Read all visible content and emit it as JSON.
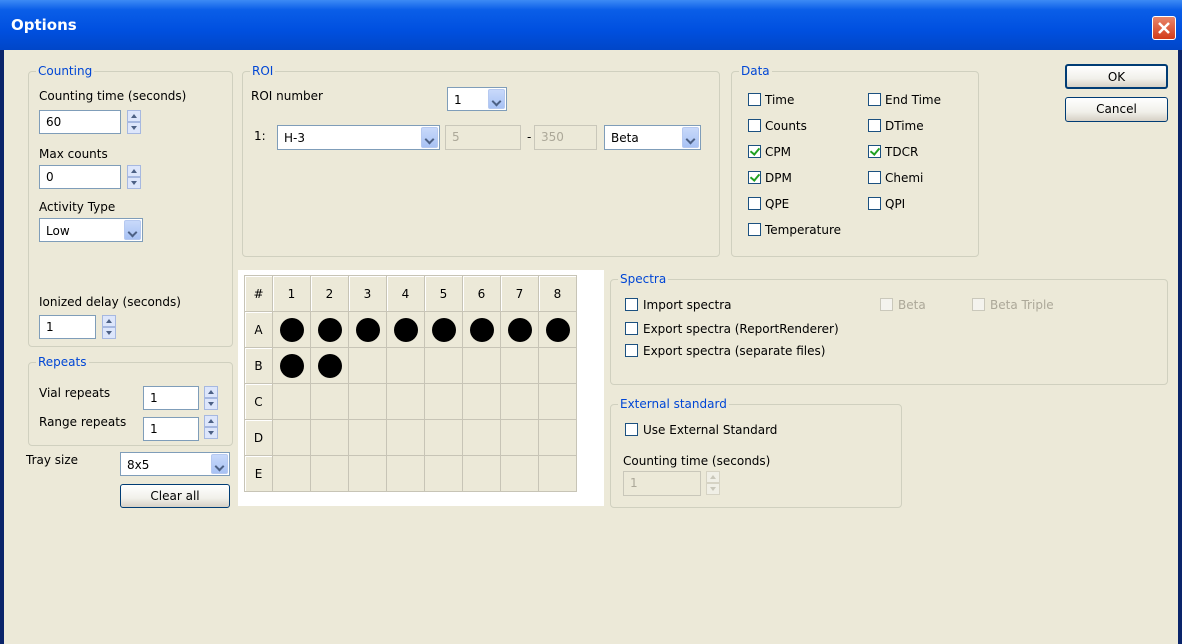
{
  "window": {
    "title": "Options"
  },
  "counting": {
    "legend": "Counting",
    "time_label": "Counting time (seconds)",
    "time_value": "60",
    "max_label": "Max counts",
    "max_value": "0",
    "activity_label": "Activity Type",
    "activity_value": "Low",
    "ionized_label": "Ionized delay (seconds)",
    "ionized_value": "1"
  },
  "repeats": {
    "legend": "Repeats",
    "vial_label": "Vial repeats",
    "vial_value": "1",
    "range_label": "Range repeats",
    "range_value": "1"
  },
  "tray": {
    "size_label": "Tray size",
    "size_value": "8x5",
    "clear_label": "Clear all",
    "corner": "#",
    "columns": [
      "1",
      "2",
      "3",
      "4",
      "5",
      "6",
      "7",
      "8"
    ],
    "rows": [
      {
        "label": "A",
        "filled": [
          true,
          true,
          true,
          true,
          true,
          true,
          true,
          true
        ]
      },
      {
        "label": "B",
        "filled": [
          true,
          true,
          false,
          false,
          false,
          false,
          false,
          false
        ]
      },
      {
        "label": "C",
        "filled": [
          false,
          false,
          false,
          false,
          false,
          false,
          false,
          false
        ]
      },
      {
        "label": "D",
        "filled": [
          false,
          false,
          false,
          false,
          false,
          false,
          false,
          false
        ]
      },
      {
        "label": "E",
        "filled": [
          false,
          false,
          false,
          false,
          false,
          false,
          false,
          false
        ]
      }
    ]
  },
  "roi": {
    "legend": "ROI",
    "number_label": "ROI number",
    "number_value": "1",
    "row_label": "1:",
    "nuclide_value": "H-3",
    "low_value": "5",
    "dash": "-",
    "high_value": "350",
    "type_value": "Beta"
  },
  "data": {
    "legend": "Data",
    "items": [
      {
        "label": "Time",
        "checked": false
      },
      {
        "label": "Counts",
        "checked": false
      },
      {
        "label": "CPM",
        "checked": true
      },
      {
        "label": "DPM",
        "checked": true
      },
      {
        "label": "QPE",
        "checked": false
      },
      {
        "label": "Temperature",
        "checked": false
      },
      {
        "label": "End Time",
        "checked": false
      },
      {
        "label": "DTime",
        "checked": false
      },
      {
        "label": "TDCR",
        "checked": true
      },
      {
        "label": "Chemi",
        "checked": false
      },
      {
        "label": "QPI",
        "checked": false
      }
    ]
  },
  "buttons": {
    "ok": "OK",
    "cancel": "Cancel"
  },
  "spectra": {
    "legend": "Spectra",
    "import_label": "Import spectra",
    "export_report_label": "Export spectra (ReportRenderer)",
    "export_separate_label": "Export spectra (separate files)",
    "beta_label": "Beta",
    "beta_triple_label": "Beta Triple"
  },
  "external": {
    "legend": "External standard",
    "use_label": "Use External Standard",
    "time_label": "Counting time (seconds)",
    "time_value": "1"
  },
  "colors": {
    "title_bar": "#0054e3",
    "client_bg": "#ece9d8",
    "group_legend": "#0046d5",
    "close_button": "#d33b1a"
  }
}
